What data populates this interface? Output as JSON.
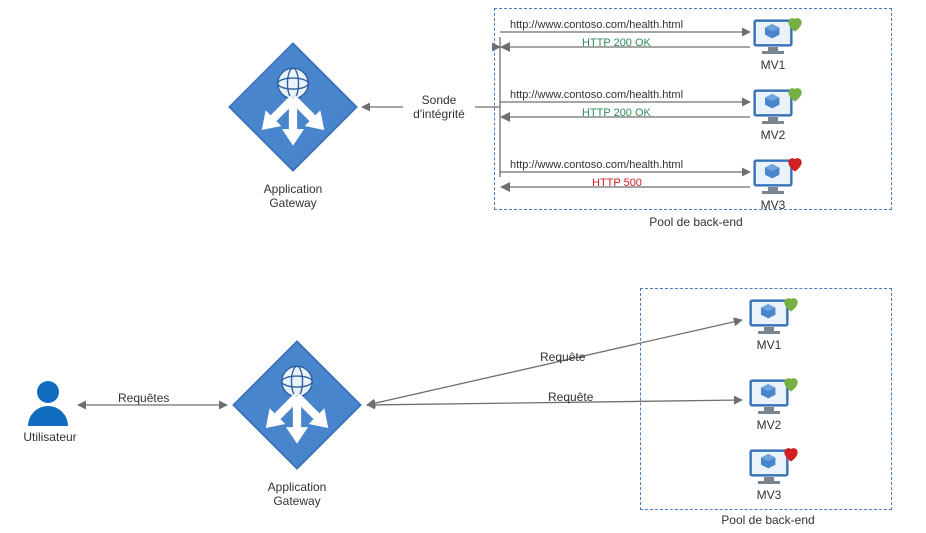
{
  "top": {
    "gateway_label": "Application\nGateway",
    "probe_label": "Sonde\nd'intégrité",
    "pool_label": "Pool de back-end",
    "health_url": "http://www.contoso.com/health.html",
    "resp_ok": "HTTP 200 OK",
    "resp_err": "HTTP 500",
    "vm1": "MV1",
    "vm2": "MV2",
    "vm3": "MV3"
  },
  "bottom": {
    "user_label": "Utilisateur",
    "requests_label": "Requêtes",
    "request_label_1": "Requête",
    "request_label_2": "Requête",
    "gateway_label": "Application\nGateway",
    "pool_label": "Pool de back-end",
    "vm1": "MV1",
    "vm2": "MV2",
    "vm3": "MV3"
  },
  "colors": {
    "azure_blue": "#3973b9",
    "ok_green": "#5fa641",
    "err_red": "#d12020",
    "line_gray": "#6f6f6f"
  }
}
